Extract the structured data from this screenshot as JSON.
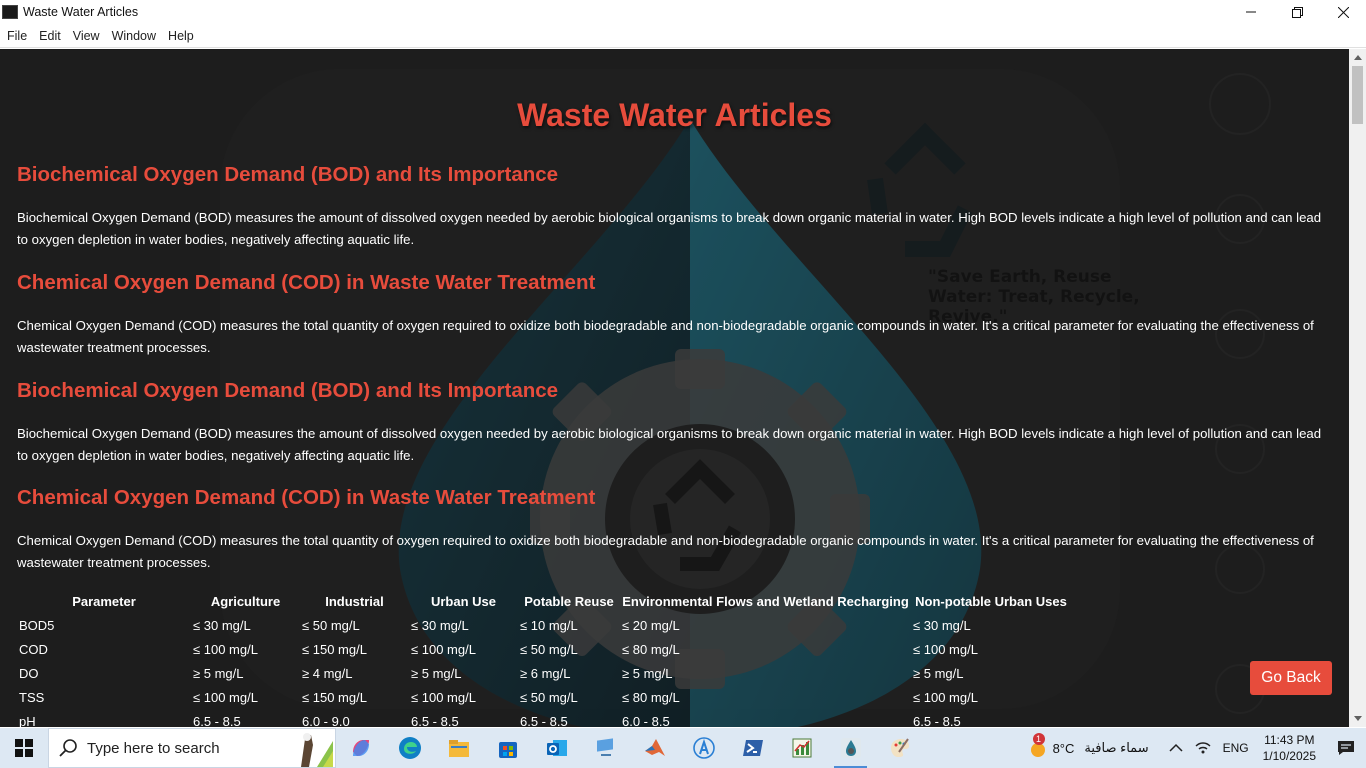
{
  "window": {
    "title": "Waste Water Articles"
  },
  "menu": {
    "items": [
      "File",
      "Edit",
      "View",
      "Window",
      "Help"
    ]
  },
  "page": {
    "title": "Waste Water Articles",
    "background_quote": "\"Save Earth, Reuse Water: Treat, Recycle, Revive.\"",
    "articles": [
      {
        "heading": "Biochemical Oxygen Demand (BOD) and Its Importance",
        "body": "Biochemical Oxygen Demand (BOD) measures the amount of dissolved oxygen needed by aerobic biological organisms to break down organic material in water. High BOD levels indicate a high level of pollution and can lead to oxygen depletion in water bodies, negatively affecting aquatic life."
      },
      {
        "heading": "Chemical Oxygen Demand (COD) in Waste Water Treatment",
        "body": "Chemical Oxygen Demand (COD) measures the total quantity of oxygen required to oxidize both biodegradable and non-biodegradable organic compounds in water. It's a critical parameter for evaluating the effectiveness of wastewater treatment processes."
      },
      {
        "heading": "Biochemical Oxygen Demand (BOD) and Its Importance",
        "body": "Biochemical Oxygen Demand (BOD) measures the amount of dissolved oxygen needed by aerobic biological organisms to break down organic material in water. High BOD levels indicate a high level of pollution and can lead to oxygen depletion in water bodies, negatively affecting aquatic life."
      },
      {
        "heading": "Chemical Oxygen Demand (COD) in Waste Water Treatment",
        "body": "Chemical Oxygen Demand (COD) measures the total quantity of oxygen required to oxidize both biodegradable and non-biodegradable organic compounds in water. It's a critical parameter for evaluating the effectiveness of wastewater treatment processes."
      }
    ],
    "table": {
      "headers": [
        "Parameter",
        "Agriculture",
        "Industrial",
        "Urban Use",
        "Potable Reuse",
        "Environmental Flows and Wetland Recharging",
        "Non-potable Urban Uses"
      ],
      "rows": [
        [
          "BOD5",
          "≤ 30 mg/L",
          "≤ 50 mg/L",
          "≤ 30 mg/L",
          "≤ 10 mg/L",
          "≤ 20 mg/L",
          "≤ 30 mg/L"
        ],
        [
          "COD",
          "≤ 100 mg/L",
          "≤ 150 mg/L",
          "≤ 100 mg/L",
          "≤ 50 mg/L",
          "≤ 80 mg/L",
          "≤ 100 mg/L"
        ],
        [
          "DO",
          "≥ 5 mg/L",
          "≥ 4 mg/L",
          "≥ 5 mg/L",
          "≥ 6 mg/L",
          "≥ 5 mg/L",
          "≥ 5 mg/L"
        ],
        [
          "TSS",
          "≤ 100 mg/L",
          "≤ 150 mg/L",
          "≤ 100 mg/L",
          "≤ 50 mg/L",
          "≤ 80 mg/L",
          "≤ 100 mg/L"
        ],
        [
          "pH",
          "6.5 - 8.5",
          "6.0 - 9.0",
          "6.5 - 8.5",
          "6.5 - 8.5",
          "6.0 - 8.5",
          "6.5 - 8.5"
        ]
      ]
    },
    "go_back_label": "Go Back"
  },
  "taskbar": {
    "search_placeholder": "Type here to search",
    "weather_badge": "1",
    "temperature": "8°C",
    "weather_text": "سماء صافية",
    "language": "ENG",
    "time": "11:43 PM",
    "date": "1/10/2025",
    "apps": [
      "copilot-icon",
      "edge-icon",
      "file-explorer-icon",
      "store-icon",
      "outlook-icon",
      "desktop-app-icon",
      "matlab-icon",
      "atom-icon",
      "powershell-icon",
      "chart-app-icon",
      "water-app-icon",
      "paint-icon"
    ]
  },
  "colors": {
    "accent": "#e74c3c",
    "content_bg": "#2b2b2b",
    "taskbar_bg": "#dde8f3"
  }
}
